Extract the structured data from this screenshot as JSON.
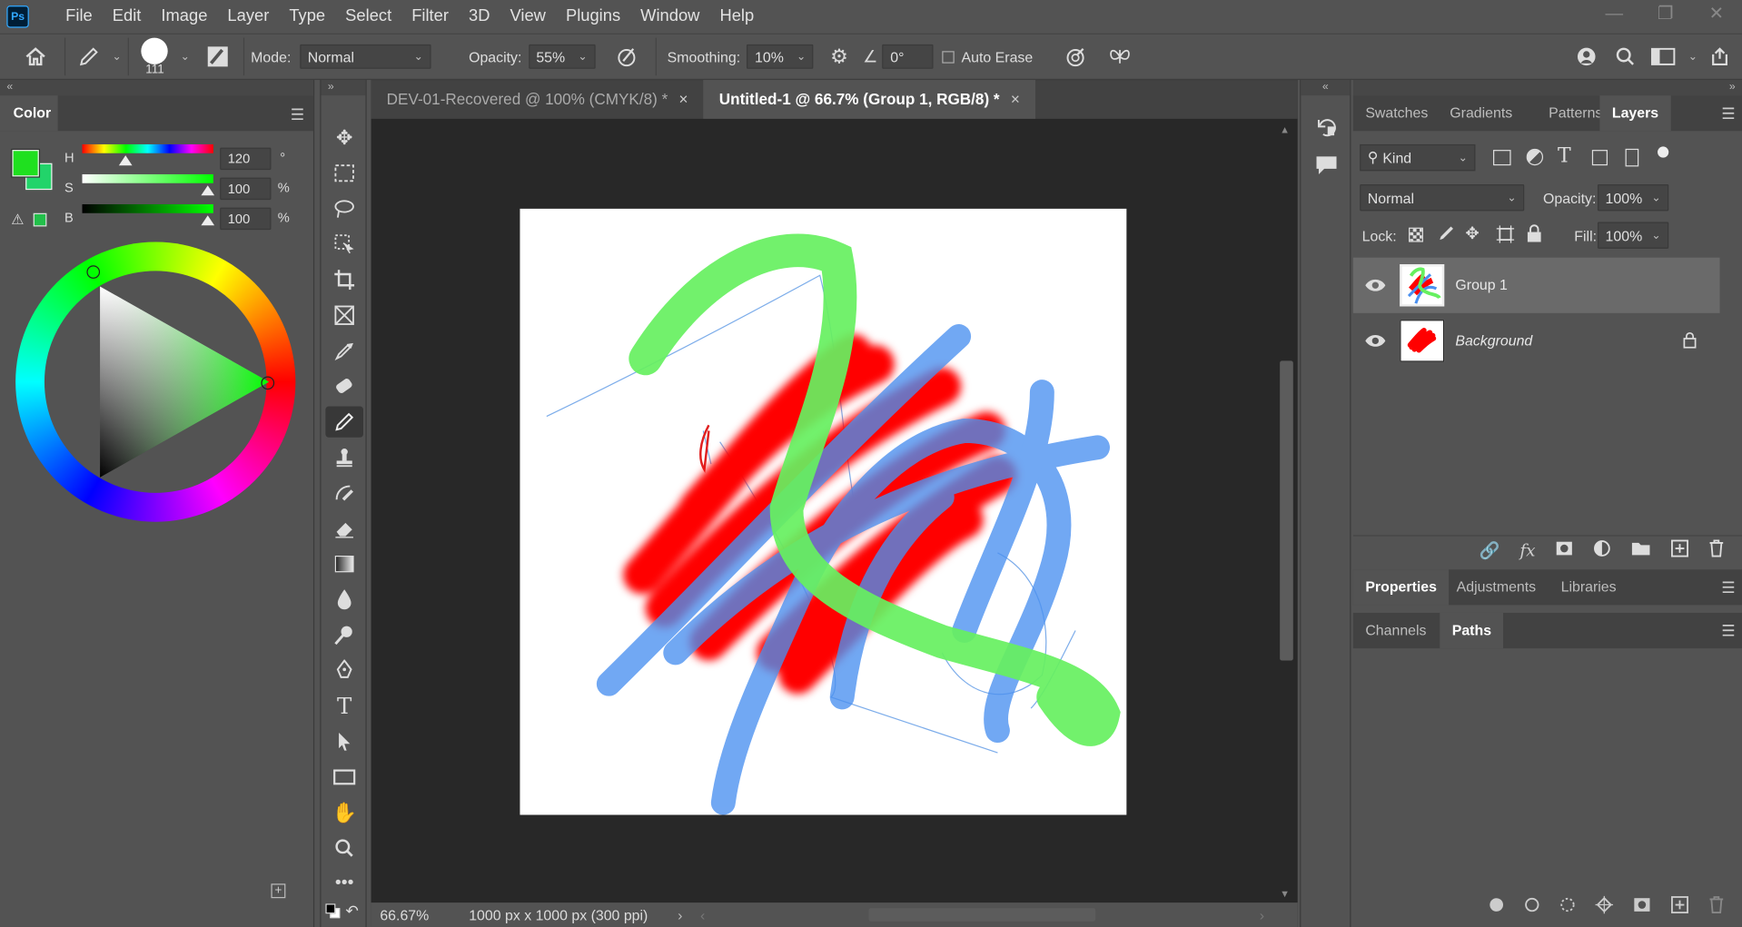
{
  "menubar": {
    "logo": "Ps",
    "items": [
      "File",
      "Edit",
      "Image",
      "Layer",
      "Type",
      "Select",
      "Filter",
      "3D",
      "View",
      "Plugins",
      "Window",
      "Help"
    ]
  },
  "options": {
    "brush_size": "111",
    "mode_label": "Mode:",
    "mode_value": "Normal",
    "opacity_label": "Opacity:",
    "opacity_value": "55%",
    "smoothing_label": "Smoothing:",
    "smoothing_value": "10%",
    "angle_value": "0°",
    "auto_erase_label": "Auto Erase"
  },
  "color_panel": {
    "tab": "Color",
    "h_label": "H",
    "h_value": "120",
    "h_unit": "°",
    "s_label": "S",
    "s_value": "100",
    "s_unit": "%",
    "b_label": "B",
    "b_value": "100",
    "b_unit": "%",
    "foreground": "#1fe01f",
    "background": "#22d46a"
  },
  "document": {
    "tabs": [
      {
        "label": "DEV-01-Recovered @ 100% (CMYK/8) *",
        "close": "×"
      },
      {
        "label": "Untitled-1 @ 66.7% (Group 1, RGB/8) *",
        "close": "×"
      }
    ],
    "zoom": "66.67%",
    "doc_info": "1000 px x 1000 px (300 ppi)"
  },
  "layers_panel": {
    "tabs": [
      "Swatches",
      "Gradients",
      "Patterns",
      "Layers"
    ],
    "filter_kind": "Kind",
    "blend_mode": "Normal",
    "opacity_label": "Opacity:",
    "opacity_value": "100%",
    "lock_label": "Lock:",
    "fill_label": "Fill:",
    "fill_value": "100%",
    "layers": [
      {
        "name": "Group 1"
      },
      {
        "name": "Background"
      }
    ]
  },
  "properties_panel": {
    "tabs": [
      "Properties",
      "Adjustments",
      "Libraries"
    ]
  },
  "paths_panel": {
    "tabs": [
      "Channels",
      "Paths"
    ]
  }
}
